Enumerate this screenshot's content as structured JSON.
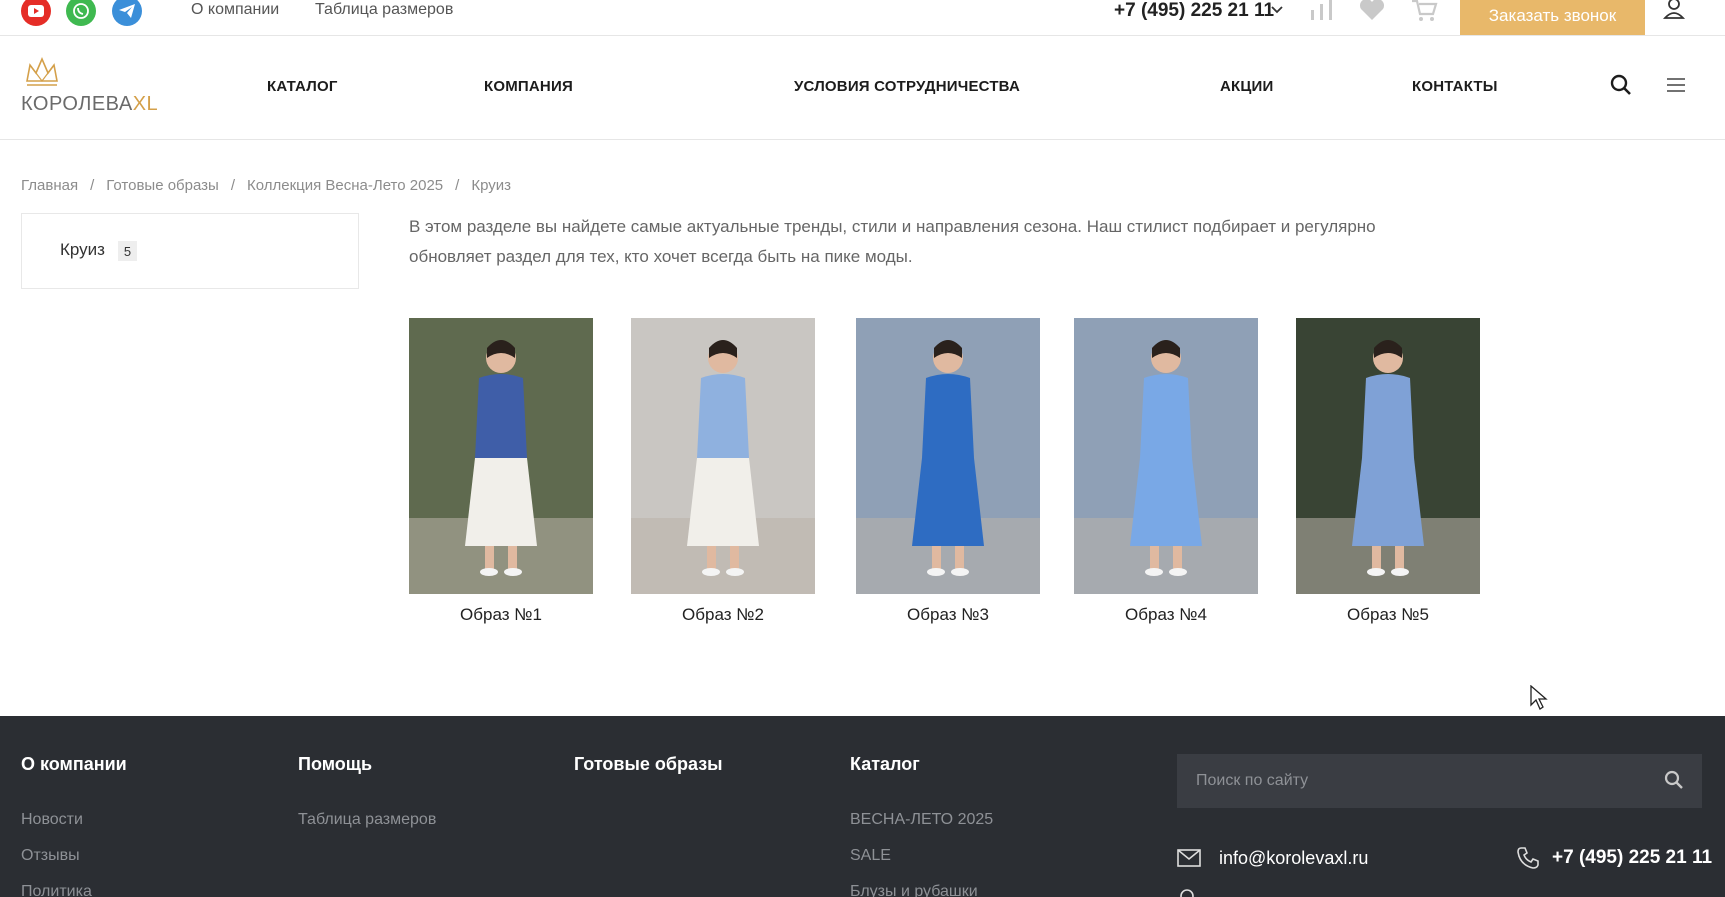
{
  "topbar": {
    "social": [
      {
        "name": "youtube-icon"
      },
      {
        "name": "whatsapp-icon"
      },
      {
        "name": "telegram-icon"
      }
    ],
    "links": [
      "О компании",
      "Таблица размеров"
    ],
    "phone": "+7 (495) 225 21 11",
    "callback_label": "Заказать звонок"
  },
  "header": {
    "logo_text": "КОРОЛЕВА",
    "logo_xl": "XL",
    "nav": [
      "КАТАЛОГ",
      "КОМПАНИЯ",
      "УСЛОВИЯ СОТРУДНИЧЕСТВА",
      "АКЦИИ",
      "КОНТАКТЫ"
    ]
  },
  "breadcrumb": [
    "Главная",
    "Готовые образы",
    "Коллекция Весна-Лето 2025",
    "Круиз"
  ],
  "sidebar": {
    "label": "Круиз",
    "count": "5"
  },
  "description": "В этом разделе вы найдете самые актуальные тренды, стили и направления сезона. Наш стилист подбирает и регулярно обновляет раздел для тех, кто хочет всегда быть на пике моды.",
  "looks": [
    {
      "caption": "Образ №1",
      "top": "#3f5ea8",
      "bottom": "#f1efea",
      "bg": "#5f6a4f"
    },
    {
      "caption": "Образ №2",
      "top": "#8fb1df",
      "bottom": "#f1efea",
      "bg": "#c9c6c2"
    },
    {
      "caption": "Образ №3",
      "top": "#2e6cc2",
      "bottom": "#2e6cc2",
      "bg": "#8fa0b6"
    },
    {
      "caption": "Образ №4",
      "top": "#79a8e6",
      "bottom": "#79a8e6",
      "bg": "#8fa0b6"
    },
    {
      "caption": "Образ №5",
      "top": "#7fa1d6",
      "bottom": "#7fa1d6",
      "bg": "#394434"
    }
  ],
  "footer": {
    "headings": [
      "О компании",
      "Помощь",
      "Готовые образы",
      "Каталог"
    ],
    "about_links": [
      "Новости",
      "Отзывы",
      "Политика"
    ],
    "help_links": [
      "Таблица размеров"
    ],
    "catalog_links": [
      "ВЕСНА-ЛЕТО 2025",
      "SALE",
      "Блузы и рубашки"
    ],
    "search_placeholder": "Поиск по сайту",
    "email": "info@korolevaxl.ru",
    "phone": "+7 (495) 225 21 11"
  },
  "colors": {
    "accent": "#e8b86a",
    "footer_bg": "#2b2e33",
    "text_dark": "#1c1c1c"
  }
}
